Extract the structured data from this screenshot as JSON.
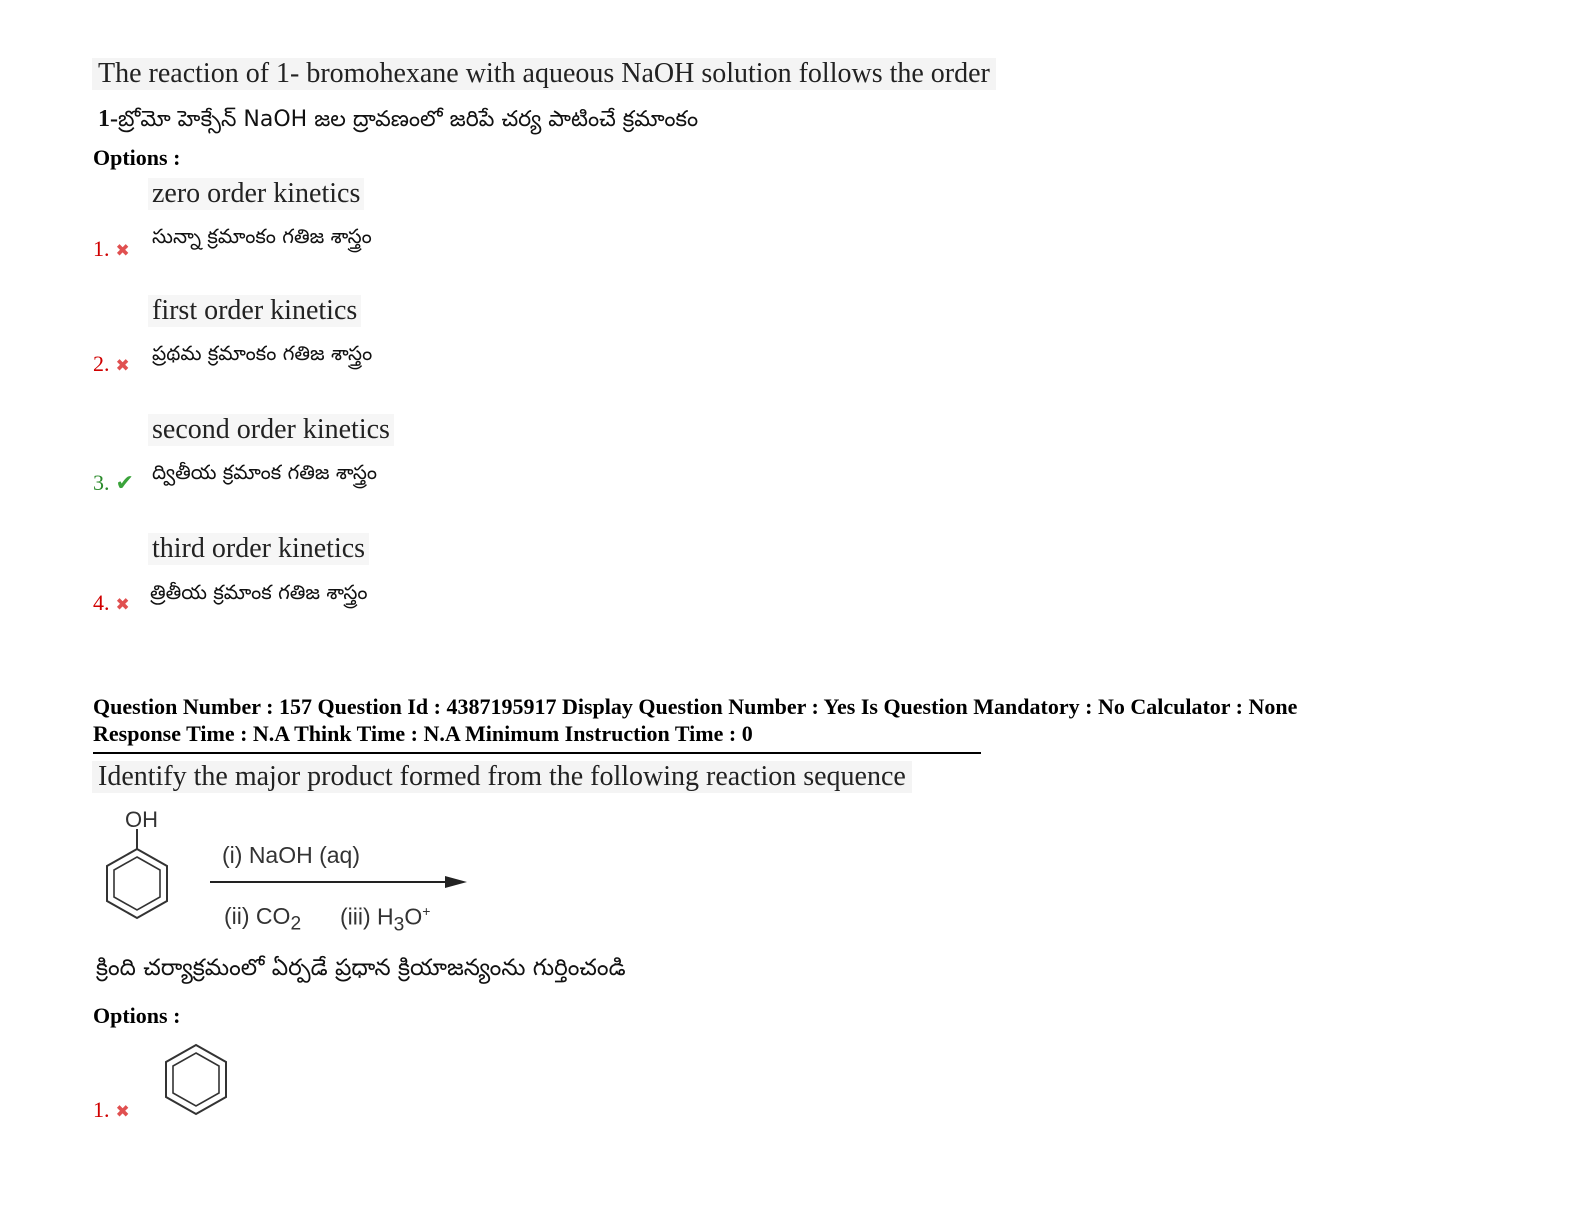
{
  "q1": {
    "prefix": "1-",
    "question_en": "The reaction of 1- bromohexane with aqueous  NaOH solution follows the order",
    "question_te": "బ్రోమో హెక్సేన్ NaOH జల ద్రావణంలో జరిపే చర్య  పాటించే క్రమాంకం",
    "options_label": "Options :",
    "options": [
      {
        "num": "1.",
        "status": "wrong",
        "en": "zero order kinetics",
        "te": "సున్నా క్రమాంకం గతిజ శాస్త్రం"
      },
      {
        "num": "2.",
        "status": "wrong",
        "en": "first order kinetics",
        "te": "ప్రథమ క్రమాంకం గతిజ శాస్త్రం"
      },
      {
        "num": "3.",
        "status": "correct",
        "en": "second order kinetics",
        "te": "ద్వితీయ క్రమాంక గతిజ శాస్త్రం"
      },
      {
        "num": "4.",
        "status": "wrong",
        "en": "third order kinetics",
        "te": "త్రితీయ క్రమాంక గతిజ శాస్త్రం"
      }
    ]
  },
  "q2": {
    "meta_line1": "Question Number : 157 Question Id : 4387195917 Display Question Number : Yes Is Question Mandatory : No Calculator : None",
    "meta_line2": "Response Time : N.A Think Time : N.A Minimum Instruction Time : 0",
    "question_en": "Identify the major product formed from the following reaction sequence",
    "reaction": {
      "substituent": "OH",
      "reagent1": "(i)  NaOH (aq)",
      "reagent2": "(ii) CO",
      "reagent2_sub": "2",
      "reagent3": "(iii) H",
      "reagent3_sub": "3",
      "reagent3_tail": "O",
      "reagent3_sup": "+"
    },
    "question_te": "క్రింది చర్యాక్రమంలో ఏర్పడే ప్రధాన క్రియాజన్యంను గుర్తించండి",
    "options_label": "Options :",
    "options": [
      {
        "num": "1.",
        "status": "wrong"
      }
    ]
  },
  "marks": {
    "wrong": "✖",
    "correct": "✔"
  },
  "colors": {
    "wrong": "#d00000",
    "correct": "#2a8a2a"
  }
}
